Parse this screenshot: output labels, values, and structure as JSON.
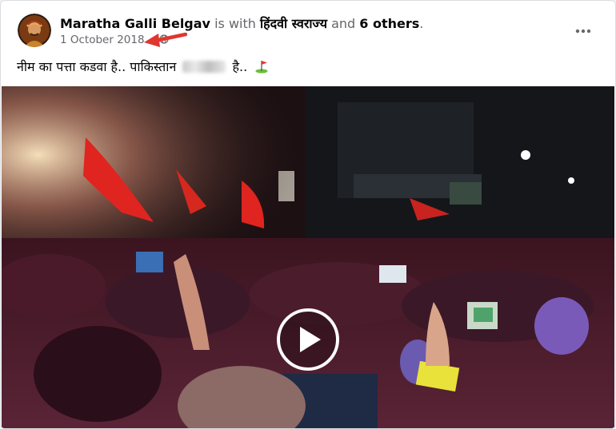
{
  "post": {
    "author": "Maratha Galli Belgav",
    "with_text": "is with",
    "tagged_page": "हिंदवी स्वराज्य",
    "and_text": "and",
    "others": "6 others",
    "period": ".",
    "date": "1 October 2018",
    "date_separator": "·",
    "text_before": "नीम का पत्ता कडवा है.. पाकिस्तान",
    "text_after": "है..",
    "icons": {
      "avatar": "warrior-portrait-avatar",
      "audience": "globe-icon",
      "more": "more-options-icon",
      "annotation": "red-arrow-icon",
      "emoji": "golf-flag-icon",
      "play": "play-icon"
    }
  },
  "colors": {
    "name_text": "#050505",
    "meta_text": "#65676b",
    "arrow": "#e0362f"
  }
}
